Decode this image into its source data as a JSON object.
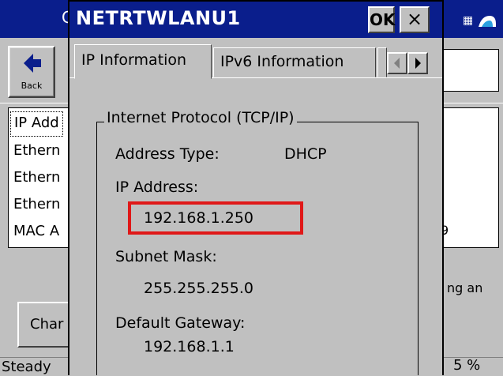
{
  "background": {
    "title_partial": "Co",
    "back_label": "Back",
    "list_items": [
      "IP Add",
      "Ethern",
      "Ethern",
      "Ethern",
      "MAC A"
    ],
    "list_right_fragment": "9",
    "desc_fragment": "ng an",
    "change_button_partial": "Char",
    "status_left": "Steady",
    "status_right": "5 %"
  },
  "dialog": {
    "title": "NETRTWLANU1",
    "ok_label": "OK",
    "close_label": "×",
    "tabs": [
      "IP Information",
      "IPv6 Information"
    ],
    "group_label": "Internet Protocol (TCP/IP)",
    "fields": {
      "address_type_label": "Address Type:",
      "address_type_value": "DHCP",
      "ip_address_label": "IP Address:",
      "ip_address_value": "192.168.1.250",
      "subnet_mask_label": "Subnet Mask:",
      "subnet_mask_value": "255.255.255.0",
      "gateway_label": "Default Gateway:",
      "gateway_value": "192.168.1.1"
    }
  },
  "colors": {
    "title_bar": "#0a1e8c",
    "face": "#c0c0c0",
    "highlight_box": "#e01818"
  }
}
